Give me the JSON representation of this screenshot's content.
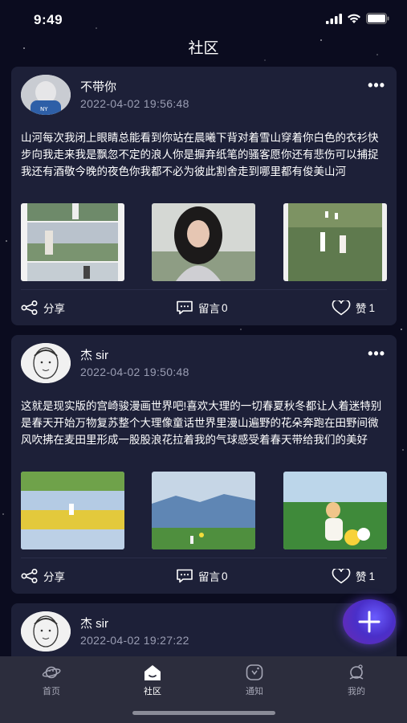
{
  "status_bar": {
    "time": "9:49"
  },
  "page_title": "社区",
  "posts": [
    {
      "username": "不带你",
      "date": "2022-04-02 19:56:48",
      "content": "山河每次我闭上眼睛总能看到你站在晨曦下背对着雪山穿着你白色的衣衫快步向我走来我是飘忽不定的浪人你是摒弃纸笔的骚客愿你还有悲伤可以捕捉我还有酒敬今晚的夜色你我都不必为彼此割舍走到哪里都有俊美山河",
      "share_label": "分享",
      "comment_label": "留言",
      "comment_count": "0",
      "like_label": "赞",
      "like_count": "1"
    },
    {
      "username": "杰 sir",
      "date": "2022-04-02 19:50:48",
      "content": "这就是现实版的宫崎骏漫画世界吧!喜欢大理的一切春夏秋冬都让人着迷特别是春天开始万物复苏整个大理像童话世界里漫山遍野的花朵奔跑在田野间微风吹拂在麦田里形成一股股浪花拉着我的气球感受着春天带给我们的美好",
      "share_label": "分享",
      "comment_label": "留言",
      "comment_count": "0",
      "like_label": "赞",
      "like_count": "1"
    },
    {
      "username": "杰 sir",
      "date": "2022-04-02 19:27:22"
    }
  ],
  "tabs": [
    {
      "label": "首页",
      "icon": "planet-icon"
    },
    {
      "label": "社区",
      "icon": "house-icon",
      "active": true
    },
    {
      "label": "通知",
      "icon": "notification-icon"
    },
    {
      "label": "我的",
      "icon": "profile-icon"
    }
  ],
  "fab_icon": "plus-icon",
  "colors": {
    "background": "#0b0c1f",
    "card": "#1d2038",
    "tabbar": "#2c2d3d",
    "fab": "#5b3fe0"
  }
}
